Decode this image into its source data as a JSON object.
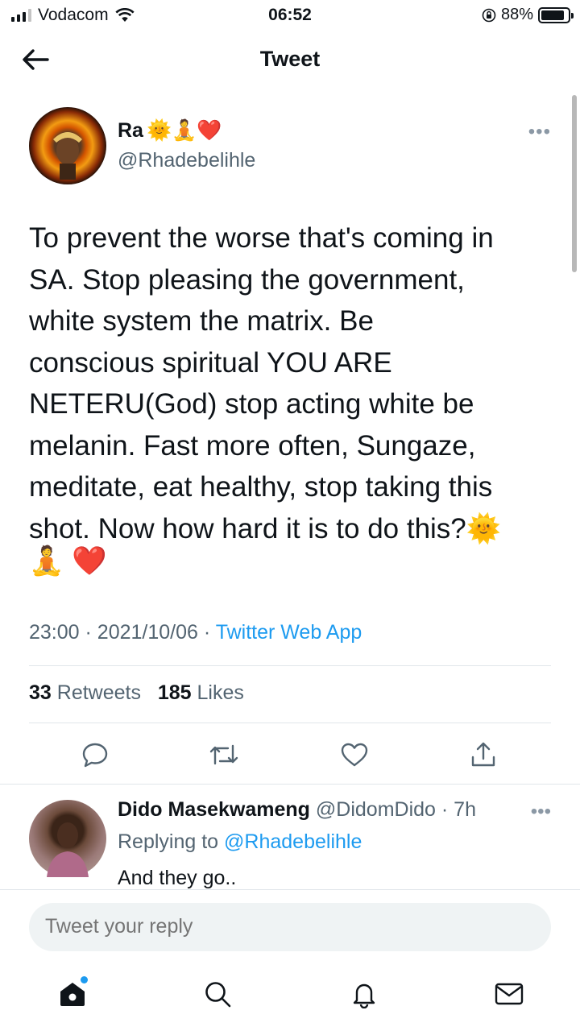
{
  "status_bar": {
    "carrier": "Vodacom",
    "time": "06:52",
    "battery": "88%",
    "battery_level": 0.88
  },
  "header": {
    "title": "Tweet"
  },
  "tweet": {
    "author_name": "Ra",
    "author_emojis": "🌞🧘❤️",
    "author_handle": "@Rhadebelihle",
    "text": "To prevent the worse that's coming in\nSA. Stop pleasing the government,\nwhite system the matrix. Be\nconscious spiritual YOU ARE\nNETERU(God) stop acting white be\nmelanin. Fast more often, Sungaze,\nmeditate, eat healthy, stop taking this\nshot. Now how hard it is to do this?🌞",
    "text_tail": "🧘 ❤️",
    "time": "23:00",
    "date": "2021/10/06",
    "source": "Twitter Web App",
    "retweets_count": "33",
    "retweets_label": "Retweets",
    "likes_count": "185",
    "likes_label": "Likes"
  },
  "reply": {
    "name": "Dido Masekwameng",
    "handle": "@DidomDido",
    "age": "· 7h",
    "replying_prefix": "Replying to",
    "replying_to": "@Rhadebelihle",
    "text": "And they go.."
  },
  "composer": {
    "placeholder": "Tweet your reply"
  },
  "icons": {
    "back": "arrow-left-icon",
    "more": "more-dots-icon",
    "reply": "comment-icon",
    "retweet": "retweet-icon",
    "like": "heart-icon",
    "share": "share-icon",
    "home": "home-icon",
    "search": "search-icon",
    "notifications": "bell-icon",
    "messages": "mail-icon"
  },
  "colors": {
    "accent": "#1d9bf0",
    "text": "#0f1419",
    "muted": "#536471"
  }
}
